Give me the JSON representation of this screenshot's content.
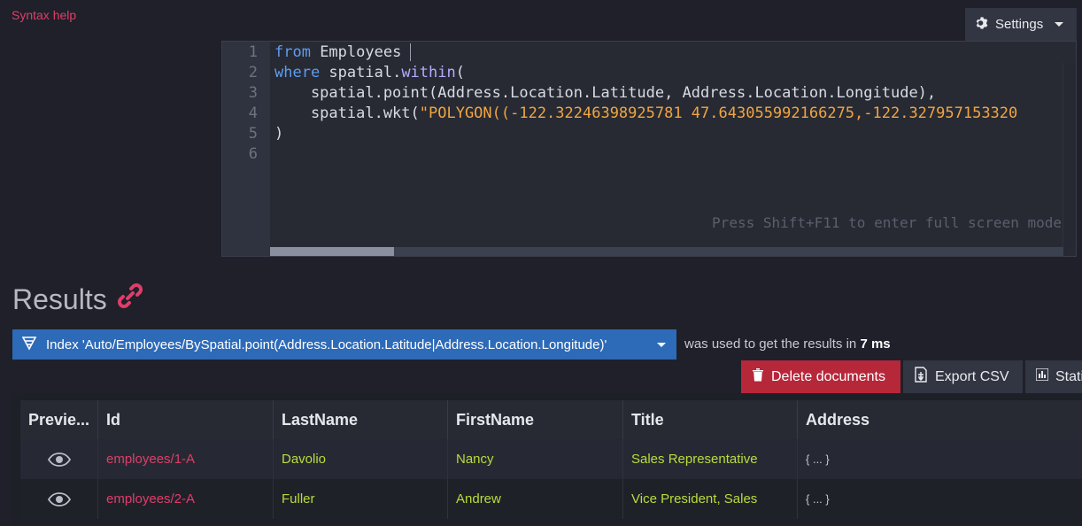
{
  "toolbar": {
    "syntax_help": "Syntax help",
    "settings_label": "Settings"
  },
  "editor": {
    "line_numbers": [
      "1",
      "2",
      "3",
      "4",
      "5",
      "6"
    ],
    "lines": [
      [
        "from",
        " Employees"
      ],
      [
        "where",
        " spatial.",
        "within",
        "("
      ],
      [
        "    spatial.point(Address.Location.Latitude, Address.Location.Longitude),"
      ],
      [
        "    spatial.wkt(",
        "\"POLYGON((-122.32246398925781 47.643055992166275,-122.327957153320"
      ],
      [
        ")"
      ],
      [
        ""
      ]
    ],
    "hint": "Press Shift+F11 to enter full screen mode"
  },
  "results": {
    "title": "Results",
    "index_label": "Index 'Auto/Employees/BySpatial.point(Address.Location.Latitude|Address.Location.Longitude)'",
    "used_text": "was used to get the results in",
    "duration": "7 ms"
  },
  "actions": {
    "delete": "Delete documents",
    "export": "Export CSV",
    "stats": "Statistics"
  },
  "table": {
    "columns": [
      "Previe...",
      "Id",
      "LastName",
      "FirstName",
      "Title",
      "Address"
    ],
    "rows": [
      {
        "id": "employees/1-A",
        "last": "Davolio",
        "first": "Nancy",
        "title": "Sales Representative",
        "address": "{ ... }"
      },
      {
        "id": "employees/2-A",
        "last": "Fuller",
        "first": "Andrew",
        "title": "Vice President, Sales",
        "address": "{ ... }"
      }
    ]
  },
  "colors": {
    "accent": "#e13d6a",
    "index_bar": "#2d6ab8",
    "delete": "#b7273a",
    "value": "#b8dc3b"
  }
}
